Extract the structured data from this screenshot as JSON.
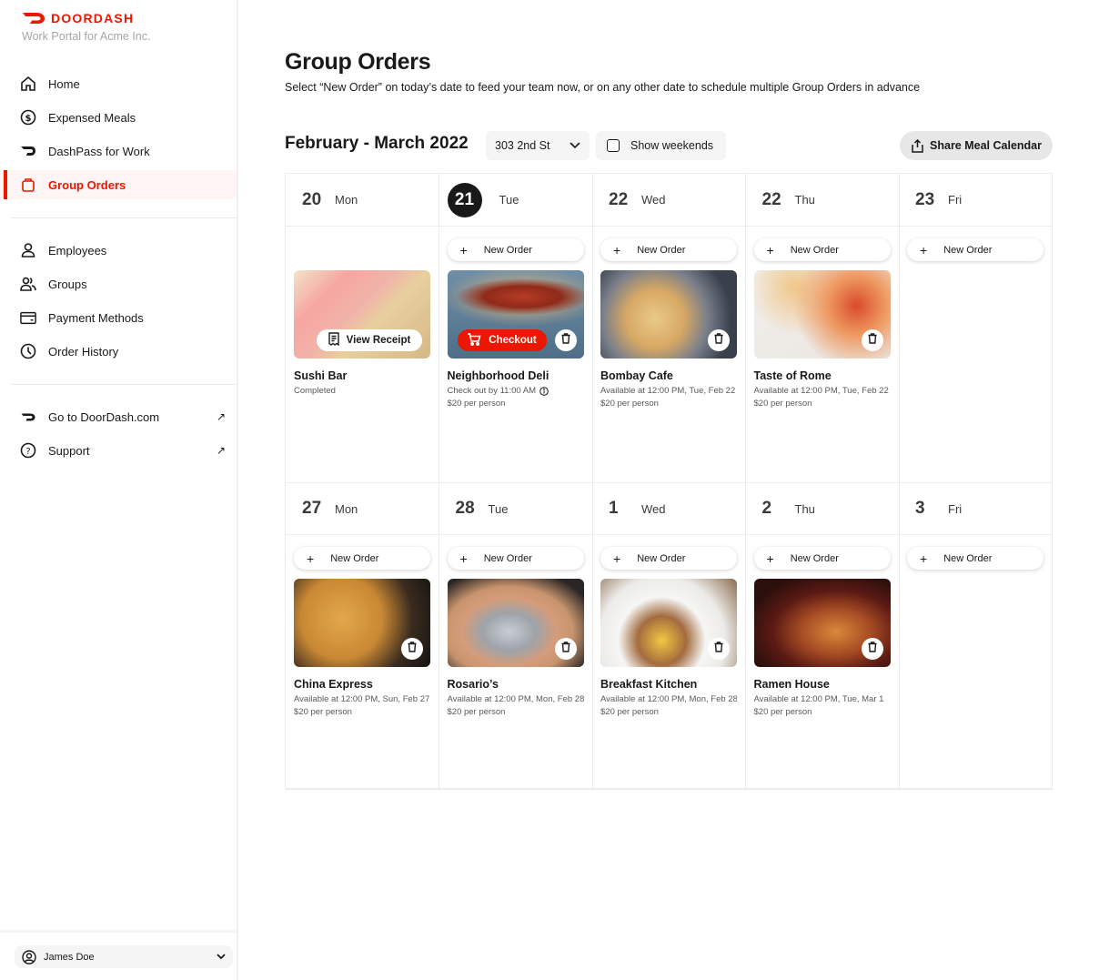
{
  "brand": {
    "name": "DOORDASH",
    "subtitle": "Work Portal for Acme Inc.",
    "accent_color": "#eb1700"
  },
  "sidebar": {
    "primary": [
      {
        "label": "Home",
        "icon": "home-icon",
        "active": false
      },
      {
        "label": "Expensed Meals",
        "icon": "dollar-circle-icon",
        "active": false
      },
      {
        "label": "DashPass for Work",
        "icon": "dashpass-icon",
        "active": false
      },
      {
        "label": "Group Orders",
        "icon": "bag-icon",
        "active": true
      }
    ],
    "manage": [
      {
        "label": "Employees",
        "icon": "person-icon"
      },
      {
        "label": "Groups",
        "icon": "people-icon"
      },
      {
        "label": "Payment Methods",
        "icon": "credit-card-icon"
      },
      {
        "label": "Order History",
        "icon": "clock-icon"
      }
    ],
    "external": [
      {
        "label": "Go to DoorDash.com",
        "icon": "doordash-logo-icon",
        "trailing": "↗"
      },
      {
        "label": "Support",
        "icon": "question-circle-icon",
        "trailing": "↗"
      }
    ],
    "user": {
      "name": "James Doe"
    }
  },
  "header": {
    "title": "Group Orders",
    "subtitle": "Select “New Order” on today’s date to feed your team now, or on any other date to schedule multiple Group Orders in advance"
  },
  "toolbar": {
    "date_range": "February - March 2022",
    "address": "303 2nd St",
    "show_weekends_label": "Show weekends",
    "show_weekends_checked": false,
    "share_label": "Share Meal Calendar"
  },
  "calendar": {
    "new_order_label": "New Order",
    "weeks": [
      {
        "days": [
          {
            "num": "20",
            "name": "Mon",
            "today": false,
            "new_order": false,
            "order": {
              "restaurant": "Sushi Bar",
              "status": "Completed",
              "price": "",
              "action": "View Receipt",
              "photo": "sushi"
            }
          },
          {
            "num": "21",
            "name": "Tue",
            "today": true,
            "new_order": true,
            "order": {
              "restaurant": "Neighborhood Deli",
              "status": "Check out by 11:00 AM",
              "price": "$20 per person",
              "action": "Checkout",
              "photo": "deli"
            }
          },
          {
            "num": "22",
            "name": "Wed",
            "today": false,
            "new_order": true,
            "order": {
              "restaurant": "Bombay Cafe",
              "status": "Available at 12:00 PM, Tue, Feb 22",
              "price": "$20 per person",
              "action": "",
              "photo": "bombay"
            }
          },
          {
            "num": "22",
            "name": "Thu",
            "today": false,
            "new_order": true,
            "order": {
              "restaurant": "Taste of Rome",
              "status": "Available at 12:00 PM, Tue, Feb 22",
              "price": "$20 per person",
              "action": "",
              "photo": "rome"
            }
          },
          {
            "num": "23",
            "name": "Fri",
            "today": false,
            "new_order": true,
            "order": null
          }
        ]
      },
      {
        "days": [
          {
            "num": "27",
            "name": "Mon",
            "today": false,
            "new_order": true,
            "order": {
              "restaurant": "China Express",
              "status": "Available at 12:00 PM, Sun, Feb 27",
              "price": "$20 per person",
              "action": "",
              "photo": "china"
            }
          },
          {
            "num": "28",
            "name": "Tue",
            "today": false,
            "new_order": true,
            "order": {
              "restaurant": "Rosario’s",
              "status": "Available at 12:00 PM, Mon, Feb 28",
              "price": "$20 per person",
              "action": "",
              "photo": "rosario"
            }
          },
          {
            "num": "1",
            "name": "Wed",
            "today": false,
            "new_order": true,
            "order": {
              "restaurant": "Breakfast Kitchen",
              "status": "Available at 12:00 PM, Mon, Feb 28",
              "price": "$20 per person",
              "action": "",
              "photo": "breakfast"
            }
          },
          {
            "num": "2",
            "name": "Thu",
            "today": false,
            "new_order": true,
            "order": {
              "restaurant": "Ramen House",
              "status": "Available at 12:00 PM, Tue, Mar 1",
              "price": "$20 per person",
              "action": "",
              "photo": "ramen"
            }
          },
          {
            "num": "3",
            "name": "Fri",
            "today": false,
            "new_order": true,
            "order": null
          }
        ]
      }
    ]
  }
}
